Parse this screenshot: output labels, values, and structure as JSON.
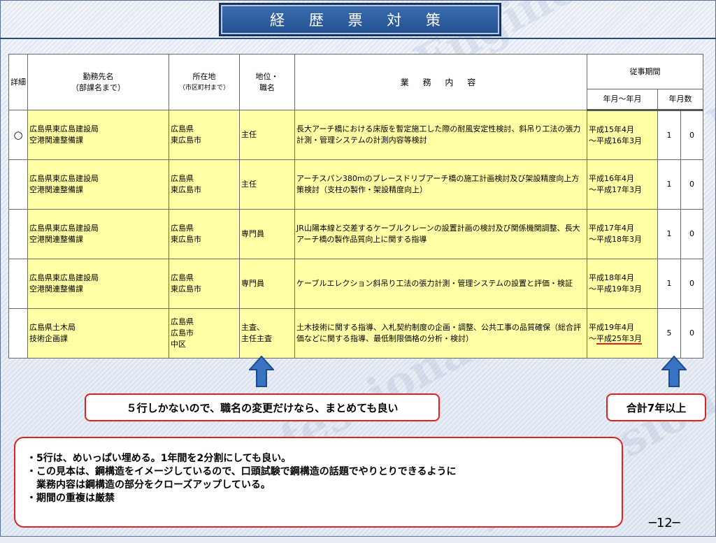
{
  "title": "経 歴 票 対 策",
  "watermark": "Professional Engineer",
  "table": {
    "headers": {
      "detail": "詳細",
      "office_line1": "勤務先名",
      "office_line2": "（部課名まで）",
      "location_line1": "所在地",
      "location_line2": "（市区町村まで）",
      "position_line1": "地位・",
      "position_line2": "職名",
      "work": "業 務 内 容",
      "period": "従事期間",
      "period_range": "年月～年月",
      "years_count": "年月数"
    },
    "rows": [
      {
        "mark": "○",
        "office1": "広島県東広島建設局",
        "office2": "空港関連整備課",
        "loc1": "広島県",
        "loc2": "東広島市",
        "loc3": "",
        "pos1": "主任",
        "pos2": "",
        "work": "長大アーチ橋における床版を暫定施工した際の耐風安定性検討、斜吊り工法の張力計測・管理システムの計測内容等検討",
        "from": "平成15年4月",
        "to": "～平成16年3月",
        "years": "1",
        "months": "0"
      },
      {
        "mark": "",
        "office1": "広島県東広島建設局",
        "office2": "空港関連整備課",
        "loc1": "広島県",
        "loc2": "東広島市",
        "loc3": "",
        "pos1": "主任",
        "pos2": "",
        "work": "アーチスパン380mのブレースドリブアーチ橋の施工計画検討及び架設精度向上方策検討（支柱の製作・架設精度向上）",
        "from": "平成16年4月",
        "to": "～平成17年3月",
        "years": "1",
        "months": "0"
      },
      {
        "mark": "",
        "office1": "広島県東広島建設局",
        "office2": "空港関連整備課",
        "loc1": "広島県",
        "loc2": "東広島市",
        "loc3": "",
        "pos1": "専門員",
        "pos2": "",
        "work": "JR山陽本線と交差するケーブルクレーンの設置計画の検討及び関係機関調整、長大アーチ橋の製作品質向上に関する指導",
        "from": "平成17年4月",
        "to": "～平成18年3月",
        "years": "1",
        "months": "0"
      },
      {
        "mark": "",
        "office1": "広島県東広島建設局",
        "office2": "空港関連整備課",
        "loc1": "広島県",
        "loc2": "東広島市",
        "loc3": "",
        "pos1": "専門員",
        "pos2": "",
        "work": "ケーブルエレクション斜吊り工法の張力計測・管理システムの設置と評価・検証",
        "from": "平成18年4月",
        "to": "～平成19年3月",
        "years": "1",
        "months": "0"
      },
      {
        "mark": "",
        "office1": "広島県土木局",
        "office2": "技術企画課",
        "loc1": "広島県",
        "loc2": "広島市",
        "loc3": "中区",
        "pos1": "主査、",
        "pos2": "主任主査",
        "work": "土木技術に関する指導、入札契約制度の企画・調整、公共工事の品質確保（総合評価などに関する指導、最低制限価格の分析・検討）",
        "from": "平成19年4月",
        "to_prefix": "～",
        "to": "平成25年3月",
        "years": "5",
        "months": "0"
      }
    ]
  },
  "callouts": {
    "position_note": "５行しかないので、職名の変更だけなら、まとめても良い",
    "total_note": "合計7年以上",
    "notes": [
      "・5行は、めいっぱい埋める。1年間を2分割にしても良い。",
      "・この見本は、鋼構造をイメージしているので、口頭試験で鋼構造の話題でやりとりできるように",
      "　業務内容は鋼構造の部分をクローズアップしている。",
      "・期間の重複は厳禁"
    ]
  },
  "page_number": "─12─",
  "colors": {
    "row_highlight": "#ffffa6",
    "callout_border": "#dd2222",
    "arrow": "#3a73c4",
    "title_bg": "#2a5a9c"
  },
  "icons": [
    "up-arrow-icon"
  ]
}
